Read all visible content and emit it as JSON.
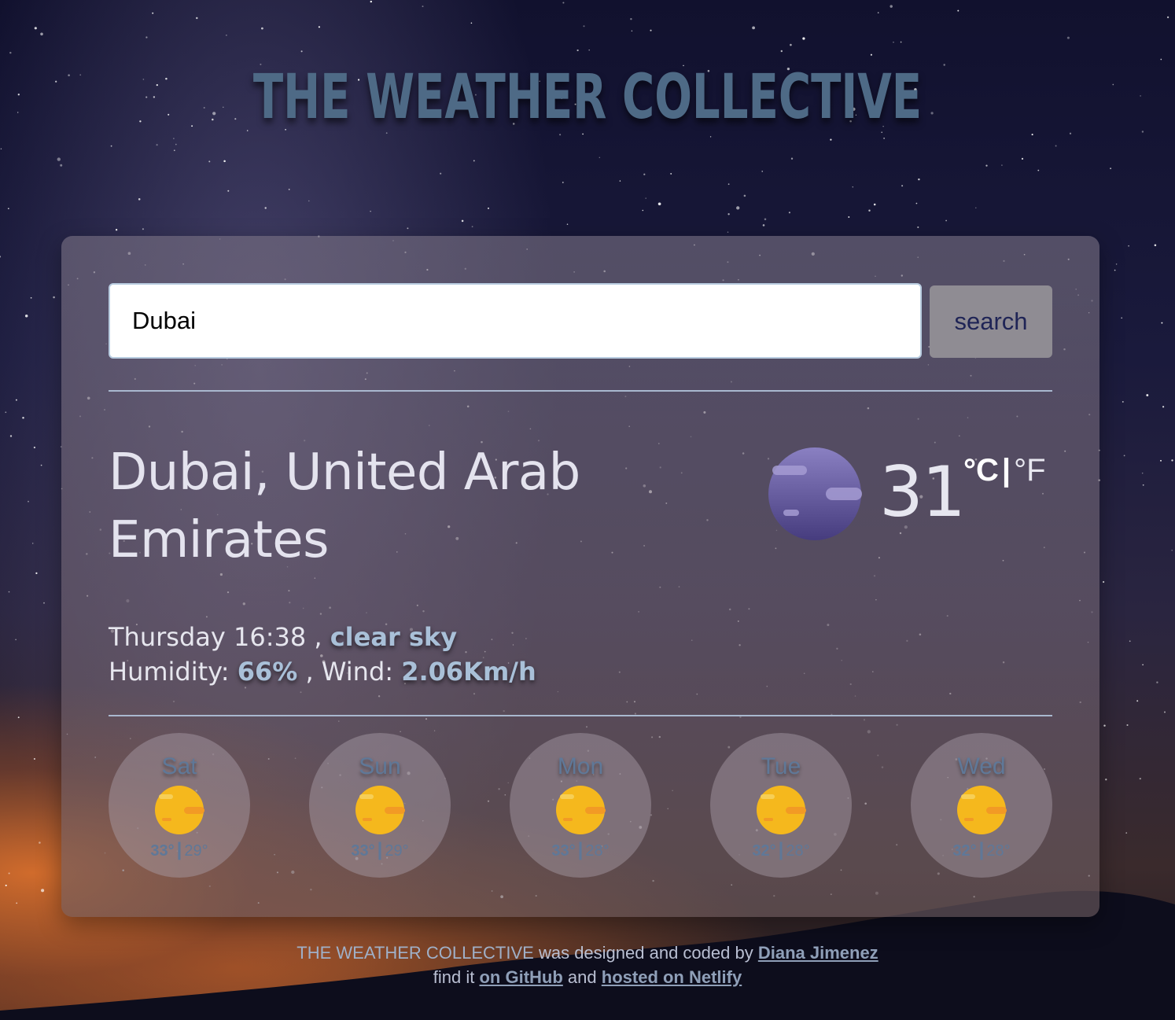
{
  "header": {
    "title": "THE WEATHER COLLECTIVE"
  },
  "search": {
    "value": "Dubai",
    "button_label": "search"
  },
  "current": {
    "city": "Dubai, United Arab Emirates",
    "temperature": "31",
    "unit_celsius": "°C",
    "unit_separator": "|",
    "unit_fahrenheit": "°F",
    "icon": "night-moon-icon",
    "day_time": "Thursday 16:38",
    "description": "clear sky",
    "humidity_label": "Humidity:",
    "humidity_value": "66%",
    "wind_label": "Wind:",
    "wind_value": "2.06Km/h",
    "separator": ","
  },
  "forecast": [
    {
      "day": "Sat",
      "max": "33°",
      "min": "29°",
      "icon": "sun-icon"
    },
    {
      "day": "Sun",
      "max": "33°",
      "min": "29°",
      "icon": "sun-icon"
    },
    {
      "day": "Mon",
      "max": "33°",
      "min": "28°",
      "icon": "sun-icon"
    },
    {
      "day": "Tue",
      "max": "32°",
      "min": "28°",
      "icon": "sun-icon"
    },
    {
      "day": "Wed",
      "max": "32°",
      "min": "28°",
      "icon": "sun-icon"
    }
  ],
  "forecast_separator": "|",
  "footer": {
    "brand": "THE WEATHER COLLECTIVE",
    "designed_text": "was designed and coded by",
    "author_link": "Diana Jimenez",
    "find_text": "find it",
    "github_link": "on GitHub",
    "and_text": "and",
    "netlify_link": "hosted on Netlify"
  },
  "colors": {
    "title": "#4e6a86",
    "highlight": "#a9c0d8",
    "search_button_bg": "#8f8c93",
    "search_button_text": "#1f2456",
    "moon": "#5e5598",
    "sun": "#f5b81d"
  }
}
